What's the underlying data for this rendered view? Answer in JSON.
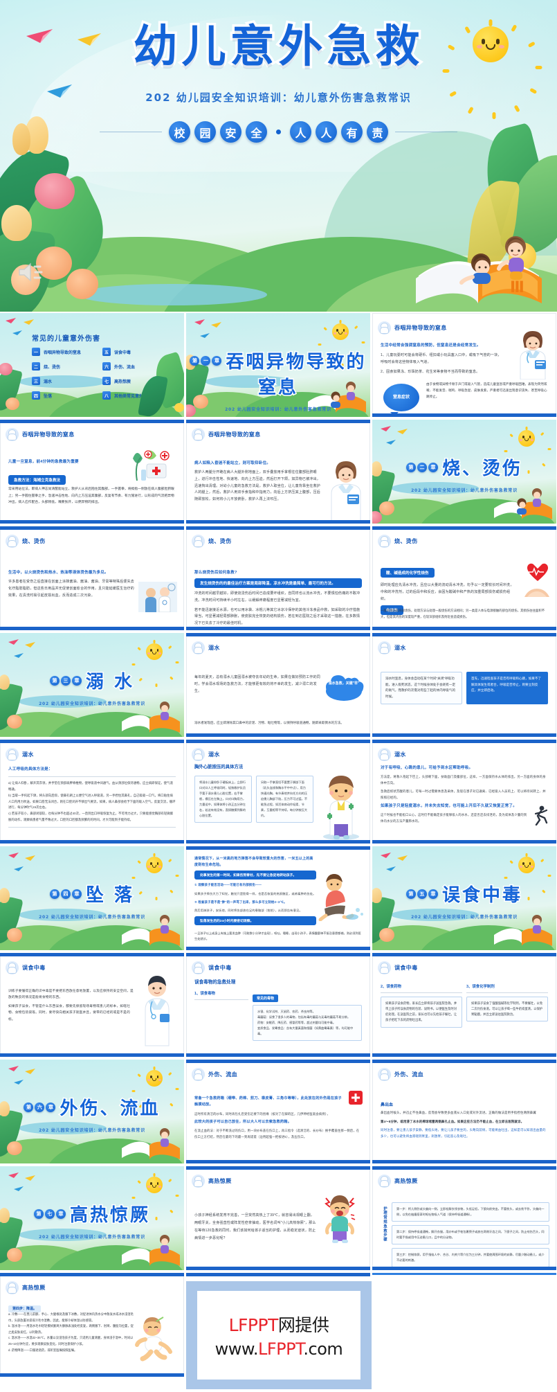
{
  "cover": {
    "title": "幼儿意外急救",
    "subtitle": "202 幼儿园安全知识培训：幼儿意外伤害急救常识",
    "badge_chars": [
      "校",
      "园",
      "安",
      "全"
    ],
    "badge_chars2": [
      "人",
      "人",
      "有",
      "责"
    ],
    "accent_blue": "#1464d8",
    "accent_yellow": "#fdc91d",
    "speaker_icon": "speaker-icon"
  },
  "toc": {
    "title": "常见的儿童意外伤害",
    "items": [
      {
        "num": "一",
        "label": "吞咽异物导致的窒息"
      },
      {
        "num": "五",
        "label": "误食中毒"
      },
      {
        "num": "二",
        "label": "烧、烫伤"
      },
      {
        "num": "六",
        "label": "外伤、流血"
      },
      {
        "num": "三",
        "label": "溺水"
      },
      {
        "num": "七",
        "label": "高热惊厥"
      },
      {
        "num": "四",
        "label": "坠落"
      },
      {
        "num": "八",
        "label": "其他类常见意外事故急救"
      }
    ]
  },
  "common": {
    "section_subtitle": "202 幼儿园安全知识培训：幼儿意外伤害急救常识"
  },
  "sections": [
    {
      "num": [
        "第",
        "一",
        "章"
      ],
      "title": "吞咽异物导致的窒息"
    },
    {
      "num": [
        "第",
        "二",
        "章"
      ],
      "title": "烧、烫伤"
    },
    {
      "num": [
        "第",
        "三",
        "章"
      ],
      "title": "溺 水"
    },
    {
      "num": [
        "第",
        "四",
        "章"
      ],
      "title": "坠 落"
    },
    {
      "num": [
        "第",
        "五",
        "章"
      ],
      "title": "误食中毒"
    },
    {
      "num": [
        "第",
        "六",
        "章"
      ],
      "title": "外伤、流血"
    },
    {
      "num": [
        "第",
        "七",
        "章"
      ],
      "title": "高热惊厥"
    }
  ],
  "slides": {
    "s3": {
      "header": "吞咽异物导致的窒息",
      "lead": "生活中经常会强调窒息的预防，但窒息还是会经常发生。",
      "p1": "1、儿童玩耍时可能会将硬币、纽扣或小玩具塞入口中，或吸下气管的一块，呼吸时会将这些物体吸入气道。",
      "p2": "2、固食如果冻、珍珠奶茶、花生米等食物不当而导致的窒息。",
      "bubble": "窒息症状",
      "p3": "由于食物或异物卡顿于声门或吸入气管，造成儿童窒息或严重呼吸困难，表现为突然咳嗽、不能发音、喘鸣、呼吸急促、皮肤发紫，严重者可迅速出现意识丧失、甚至呼吸心跳停止。"
    },
    "s4": {
      "header": "吞咽异物导致的窒息",
      "lead": "儿童一旦窒息，前4分钟的急救最为重要",
      "pill": "急救方法：海姆立克急救法",
      "p1": "常采用站位法，即病人神志尚清醒能站立，救护人从背后抱住其腹部，一手握拳，将拇指一侧放在病人腹部肚脐眼上；另一手握住握拳之手，急速冲击性地、向内上方压迫其腹部，反复有节奏、有力施进行，以形成的气流把异物冲出。病人应作配合，头部稍低，嘴要张开，以便异物的排出。"
    },
    "s5": {
      "header": "吞咽异物导致的窒息",
      "lead": "病人如陷入昏迷不能站立，则可取仰卧位。",
      "p1": "救护人两腿分开跪在病人大腿外侧地面上，双手叠放用手掌根往住腹部肚脐眼上，进行冲击性地、快速地、向内上方压迫，然后打开下颌，如异物已被冲出，迅速掏出清理。对幼小儿童的急救方法是，救护人取坐位，让儿童背靠坐在救护人的腿上，然后，救护人用双手食指和中指用力，向后上方挤压其上腹部，压后随即放松，如何将小儿平放俯卧，救护人再上法叩压。"
    },
    "s7": {
      "header": "烧、烫伤",
      "lead": "生活中，以火烧烫伤和热水、热油等液体烫伤最为多见。",
      "p1": "许多患者在受伤之后直接在创面上涂抹酱油、酱油、酱油、牙膏等特殊后便失去化疗脂肪脂肪，但这些日用品并无促使创面愈合的作用，且只能延缓医生治疗的效果，在清洗时易引起皮损出血，反而造成二次污染。"
    },
    "s8": {
      "header": "烧、烫伤",
      "lead": "那么烧烫伤后如何急救?",
      "pill": "发生烧烫伤的的最佳治疗方案是局部降温，凉水冲洗是最简单、最可行的方法。",
      "p1": "冲洗的时间越早越好，即使烧烫伤后时间已造成要坏组织，自同样也以流水冲洗，不要惧怕伤痛的不敢冲洗。冲洗时间可持续半小时左右，以缓解疼痛程度已显著减轻为宜。",
      "p2": "若不能迅速接近水源，也可以用冰袋、冰棍儿等其它冰凉冷保存的其他冷冻食品中救，如采取的冷疗措施得当，可显著减轻局部肿胀，使皮肤完全恢复的结构损伤，若在到达医院之后才采取这一措施，在多数情况下已失去了冷疗的最佳时机。"
    },
    "s9": {
      "header": "烧、烫伤",
      "pill_top": "酸、碱造成的化学性烧伤",
      "p1": "即时处理应先清水冲洗，且应以大量的流动清水冲洗，勿予以一定要较长时间冲洗，中和的冲洗剂，过的后段中和反应，会因为酸碱中和产热的加重局部损伤或损伤组织。",
      "pill_bottom": "电烧伤",
      "p2": "一般的烧伤较局部烧伤，处理方法与处理一般烧伤的方法相同；另一类是人体与电源接触的部位的烧伤，其损伤往往面积不大，但是其内伤的深度较严重，在较深部组织及附近会造成损伤。",
      "icon": "heart-pulse-icon"
    },
    "s11": {
      "header": "溺水",
      "p1": "每年的夏天，总有溺水儿童因溺水被夺去年幼的生命，如果在做好预防工作的同时，学会溺水现场的急救方法，才能够更有效的将不幸的发生，减少溺亡的发生。",
      "bubble": "溺水急救，关键\"早\"",
      "p2": "溺水者发现后，应立即清除其口鼻中的淤泥、污物、呕吐物等，以保持呼吸道通畅，随即采取倒水的方法。"
    },
    "s12": {
      "header": "溺水",
      "box1": "溺水时窒息，身体会自动在某个时间\"关闭\"呼吸功能，进入假死状态，这个时候身体处于会耗有一定的氧气，而救护的次需对有些了起的体内呼吸气的时候。",
      "box2": "首先，迅速检查孩子是否有呼吸和心跳，如果不了解具体发生或者合，呼吸是否停止，则要立刻反应，并立即启动。"
    },
    "s13": {
      "header": "溺水",
      "lead": "人工呼吸的具体方法是：",
      "a": "a) 让病人仰卧，解开其衣领，并手垫在颈部肩胛脊椎物，使呼吸道中间通气，血从颈部位保持通畅，应立病即保证，使气道畅通。",
      "b": "b) 当取一手托起下颌，将头部向后仰，使鼻孔朝上以便空气进入呼吸道，另一手捏住其鼻孔，自己吸吸一口气，将口贴住病人口内用力吹送，如果口唇无法闭合，则在口腔闭开不够出气要流，如果，病人鼻部会给予下面的吸入空气，反复交流，循环进行，每分钟吹气15次左右。",
      "c": "c) 若孩子较小，鼻部闭锁较，也每分钟不也超过40次，一直到出口呼吸恢复为止。不可用力过大，只要能感觉胸部有轻微膨胀的动作，观察病患者气量不致过大，口腔的口腔都及频繁的的时间，才大可能到子能持续。"
    },
    "s14": {
      "header": "溺水",
      "title": "胸外心脏按压的具体方法",
      "box1": "将溺水儿童仰卧于硬板床上，立即行口对口人工呼吸同时，轻按救护队员手要于溺水患儿心脏位置，右手掌根，横压在左胸上，口对口胸用力，力量适中，如果体将小孩正五分钟左右，若这有效没有，直接触摸到脉的心脏位置。",
      "box2": "另取一手掌直切不要置于脚部下面（乳头连线和胸水平中中点），用力快速向胸，有节奏地并向任方向的压迫患儿胸部下陷，压力不可过猛，不能急过程，如活体病动作轻柔、节奏，互重相等平持续，每分钟按压大约。",
      "icon": "boy-doctor-illustration"
    },
    "s15": {
      "header": "溺水",
      "lead": "对于有呼吸、心跳的患儿，可给予到水区帮助呼吸。",
      "p1": "方法是，将救人抱起下巴上，头部朝下面，扶助面门及腹部位，这样，一方面保持水从体的排出，另一方面的身体的身体中方向。",
      "p2": "急救后抓状苏醒的患儿，可每一时过需要休息及采体，及现在患子对已通离、已经吸入人员的上、可以将待间转上、并照照已经的。",
      "warn": "如果孩子只是轻度溺水，并未失去知觉，也可能上开后不久就又恢复正常了。",
      "note": "这个时候也不能松口公心，这时仍不能确定孩子能够吸入的水水，还是否还去排泄的，及为或体及少量的到体内水分的方法产量肺水的。",
      "icon": "running-person-icon"
    },
    "s17": {
      "header": "坠落",
      "lead": "通常情况下，从一米高的地方摔落不会导致较重大的伤害，一米五以上的高度则有生命危险。",
      "pill": "处事发生的第一时间，如果伤到脊柱，先不要让急促地转动孩子。",
      "q1": "① 观察孩子能否活动——可能已有内部损伤——",
      "a1": "如果孩子摔伤大力了知觉，触觉只是肋骨一样，也是否恢复的热瘀触区，或疼痛肿的伤处。",
      "q2": "② 检查孩子是不是\"肿\"的一声骂了出来，那么多可立刻给2~3℃。",
      "a2": "然后用淋孩子，安抚他，同时将伤部放在足的患脑部（拍拍），从而即告有意见。",
      "pill2": "坠落发生后的24小时内要密切观察。",
      "note": "一旦孩子以上或身上有施上要发血肿（可能数小分钟才出现），呕吐，嗜睡，出现小孩子，表情震颤神不振及意愿都输，则必须到医生处就诊。",
      "icon": "falling-boy-illustration"
    },
    "s19": {
      "header": "误食中毒",
      "p1": "训练子要懂得正确的识中毒是不要把东西放任意地放置，以及应保持的安全空间，是放的致良的情况是能将食物的东西。",
      "p2": "如果孩子误食，不管是什么东西误食，都要先保留现场毒物或患儿的标本，如呕吐物、食物包装袋等。同时，要尽快向相关孩子就医并且，要带的已经的或是不是的标。",
      "icon": "doctor-standing-illustration"
    },
    "s20": {
      "header": "误食中毒",
      "title": "误食毒物的急救处理",
      "sub1": "1、误食毒物",
      "box_head": "常见的毒物",
      "box_text": "水银、化学试剂、灭鼠药、农药、杀虫剂等。\n毒蘑菇：误食了很多人的毒物，包括有毒的蘑菇与无毒的蘑菇不易分辨。\n药物：安眠药、降压药、感冒药等等，超过剂量均可能中毒。\n变质食品、发霉食品：含有大量真菌和细菌（如黄曲霉毒素）等，均可能中毒。"
    },
    "s21": {
      "header": "误食中毒",
      "sub1": "2、误食药物",
      "box1": "如果孩子误食药物，家长应立即将孩子送医院急救。并带上孩子所误食药物的包装、说明书，以便医生及时对症处理。在送医院之前，家长也可以先给孩子催吐，让孩子把吃下去的药物吐出来。",
      "sub2": "3、误食化学制剂",
      "box2": "如果孩子误食了强酸强碱等化学制剂，不要催吐，以免二次灼伤食道。可以让孩子喝一些牛奶或蛋清，以保护胃黏膜，并且立即送往医院救治。"
    },
    "s23": {
      "header": "外伤、流血",
      "lead": "常备一个急救药箱（绷带、药棉、剪刀、橡皮膏、三角巾等等），此处放在的外伤是在孩子触摸动放。",
      "p1": "这时所有清洁的纱布，同时再包扎后受伤近要下的创缘（按对了在脚的区，几伊神经医就会病例），",
      "lead2": "此较大的孩子可以自己放在，所以大人可以去索急救药箱。",
      "p2": "在流止血的法：对于不断洗过的伤口，用一块纱布盖在伤口上，再三指令（选清洁的、长纱布）换手覆盖住那一侧后，在伤口上方打结，然后在最的下的最一到再搓搓（边用超强一把按进5），及压伤口。",
      "icon": "first-aid-kit-icon"
    },
    "s24": {
      "header": "外伤、流血",
      "title": "鼻出血",
      "p1": "鼻出血时候头，并迅止不住鼻血，反而会导致更多血液从入口处或对外流进。正确的做法是用手指捏住两侧鼻翼",
      "p2": "第4～8分钟，或用浸了冰水的棉球堵塞两侧鼻孔止血。如果这些方法仍不能止血，在立即去医院就诊。",
      "p3": "同时注意，要让患儿孩子安静，要低头地，要让儿孩子要坐的，头略向前倾，可能将血吐出，这样是可以知道出血量的多少，也可以避免将血液咽到胃里，刺激胃，引起恶心及呕吐。"
    },
    "s26": {
      "header": "高热惊厥",
      "p1": "小孩子神经系统发育不完善，一旦突然高热上了39℃，就容易出现眼上翻，两眼牙关，全身强直性或阵发性痉挛抽动，医学名词叫\"小儿高热惊厥\"，那么在等待120急救的同时，我们该如何给孩子适当的护理，从而稳定症状，防止病情进一步恶化呢?",
      "icon": "crying-child-illustration"
    },
    "s27": {
      "header": "高热惊厥",
      "side_label": "护理常规急救步骤",
      "step1": "第一步：将儿侧卧或头偏向一侧，立即松解衣领衣物，头低足低，下颌向前突出，不要枕头，或去枕平卧，头偏向一侧，以免在抽搐痉挛时呕吐物吸入气道（保持呼吸道通畅）。",
      "step2": "第二步：保持呼吸道通畅，解开衣服，用纱布或手帕包裹筷子或放在两侧牙齿之间，下颌子之间，防止咬伤舌头，同时要手指或用中压迫患儿口，且中的分泌物。",
      "step3": "第三步：控制惊厥，用手指掐人中、合谷、内关穴等穴位为三分钟，并要使周围环境的安静，尽量少触动患儿，或少不必要的刺激。"
    },
    "s28": {
      "header": "高热惊厥",
      "label": "第四步：降温。",
      "a": "a. 冷敷——在患儿前额、手心、大腿根处及腋下冰敷，对促进体内热水分中散发水或冰水浸湿毛巾，头部放置冰袋或冷毛巾湿敷，因此，能够冷却体温以防感冒。",
      "b": "b. 温水浴——用温水毛巾轻轻擦拭腋窝大静脉表浅处经反复，两侧腋下、肘窝、腹股沟位置，促之类皮肤发红，以利散热。",
      "c": "c. 温水浴——水温32~36℃，水量以没浸泡孩子为度，只适用儿童清醒，身体浸于温中，时间以25~10分钟为宜，要多观察皮肤变化，同时注意保护小孩。",
      "d": "d. 药物降温——口服退烧药，或听室医嘱按照医嘱。",
      "icon": "baby-illustration"
    }
  },
  "watermark": {
    "line1_en": "LFPPT",
    "line1_cn": "网提供",
    "line2_pre": "www.",
    "line2_brand": "LFPPT",
    "line2_post": ".com"
  }
}
